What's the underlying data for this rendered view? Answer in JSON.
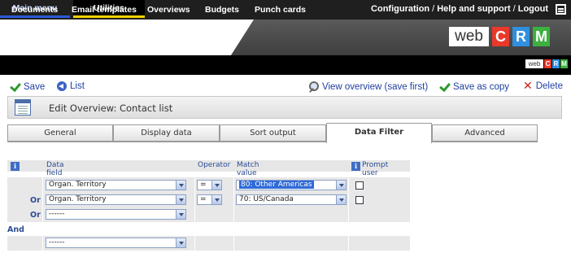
{
  "topbar": {
    "tabs": [
      "Main menu",
      "Utilities"
    ],
    "links": [
      "Configuration",
      "Help and support",
      "Logout"
    ],
    "separator": "/",
    "menu_icon": "list-icon"
  },
  "logo": {
    "word": "web",
    "letters": [
      "C",
      "R",
      "M"
    ],
    "colors": [
      "#e8392a",
      "#2f8fe0",
      "#3cb040"
    ]
  },
  "nav": {
    "items": [
      "Documents",
      "Email templates",
      "Overviews",
      "Budgets",
      "Punch cards"
    ]
  },
  "toolbar": {
    "save": "Save",
    "list": "List",
    "view_overview": "View overview (save first)",
    "save_as_copy": "Save as copy",
    "delete": "Delete"
  },
  "page": {
    "title": "Edit Overview: Contact list"
  },
  "tabs": [
    "General",
    "Display data",
    "Sort output",
    "Data Filter",
    "Advanced"
  ],
  "active_tab": "Data Filter",
  "filter": {
    "headers": {
      "info": "i",
      "data_field": "Data field",
      "operator": "Operator",
      "match_value": "Match value",
      "prompt_user": "Prompt user"
    },
    "rows": [
      {
        "label": "",
        "field": "Organ. Territory",
        "operator": "=",
        "match": "80: Other Americas",
        "match_highlighted": true,
        "prompt": false
      },
      {
        "label": "Or",
        "field": "Organ. Territory",
        "operator": "=",
        "match": "70: US/Canada",
        "match_highlighted": false,
        "prompt": false
      },
      {
        "label": "Or",
        "field": "------"
      }
    ],
    "and_label": "And",
    "and_row": {
      "field": "------"
    }
  }
}
